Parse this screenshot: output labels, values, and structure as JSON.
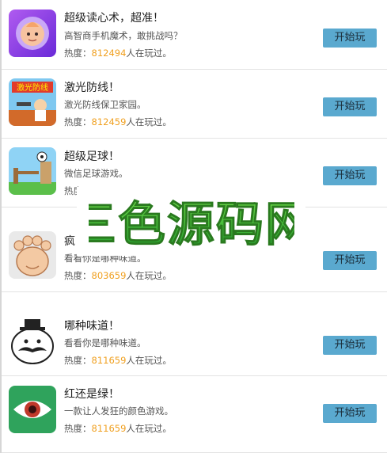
{
  "games": [
    {
      "title": "超级读心术，超准！",
      "desc": "高智商手机魔术，敢挑战吗？",
      "heat_prefix": "热度：",
      "heat_count": "812494",
      "heat_suffix": "人在玩过。",
      "button": "开始玩",
      "icon": "mind-reader-icon"
    },
    {
      "title": "激光防线！",
      "desc": "激光防线保卫家园。",
      "heat_prefix": "热度：",
      "heat_count": "812459",
      "heat_suffix": "人在玩过。",
      "button": "开始玩",
      "icon": "laser-defense-icon",
      "icon_text": "激光防线"
    },
    {
      "title": "超级足球！",
      "desc": "微信足球游戏。",
      "heat_prefix": "热度：",
      "heat_count": "",
      "heat_suffix": "",
      "button": "开始玩",
      "icon": "super-football-icon"
    },
    {
      "title": "疯",
      "desc": "看看你是哪种味道。",
      "heat_prefix": "热度：",
      "heat_count": "803659",
      "heat_suffix": "人在玩过。",
      "button": "开始玩",
      "icon": "foot-icon"
    },
    {
      "title": "哪种味道！",
      "desc": "看看你是哪种味道。",
      "heat_prefix": "热度：",
      "heat_count": "811659",
      "heat_suffix": "人在玩过。",
      "button": "开始玩",
      "icon": "mustache-face-icon"
    },
    {
      "title": "红还是绿！",
      "desc": "一款让人发狂的颜色游戏。",
      "heat_prefix": "热度：",
      "heat_count": "811659",
      "heat_suffix": "人在玩过。",
      "button": "开始玩",
      "icon": "eye-icon"
    }
  ],
  "watermark": {
    "text": "三色源码网"
  },
  "colors": {
    "button": "#5aa9cf",
    "heat_number": "#f0a020",
    "watermark_green": "#3ec23a"
  }
}
